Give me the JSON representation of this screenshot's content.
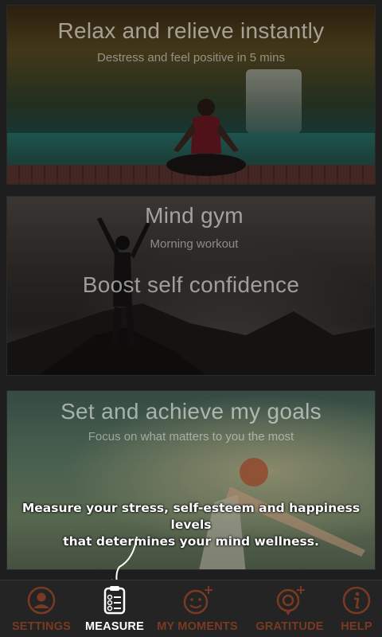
{
  "cards": [
    {
      "title": "Relax and relieve instantly",
      "subtitle": "Destress and feel positive in 5 mins"
    },
    {
      "title": "Mind gym",
      "subtitle": "Morning workout",
      "title2": "Boost self confidence"
    },
    {
      "title": "Set and achieve my goals",
      "subtitle": "Focus on what matters to you the most"
    }
  ],
  "tooltip": {
    "line1": "Measure your stress, self-esteem and happiness levels",
    "line2": "that determines your mind wellness."
  },
  "nav": {
    "items": [
      {
        "label": "SETTINGS",
        "icon": "profile-icon",
        "active": false
      },
      {
        "label": "MEASURE",
        "icon": "checklist-icon",
        "active": true
      },
      {
        "label": "MY MOMENTS",
        "icon": "smiley-plus-icon",
        "active": false
      },
      {
        "label": "GRATITUDE",
        "icon": "gratitude-plus-icon",
        "active": false
      },
      {
        "label": "HELP",
        "icon": "info-icon",
        "active": false
      }
    ],
    "accent_color": "#7a3a22",
    "active_color": "#ffffff"
  }
}
